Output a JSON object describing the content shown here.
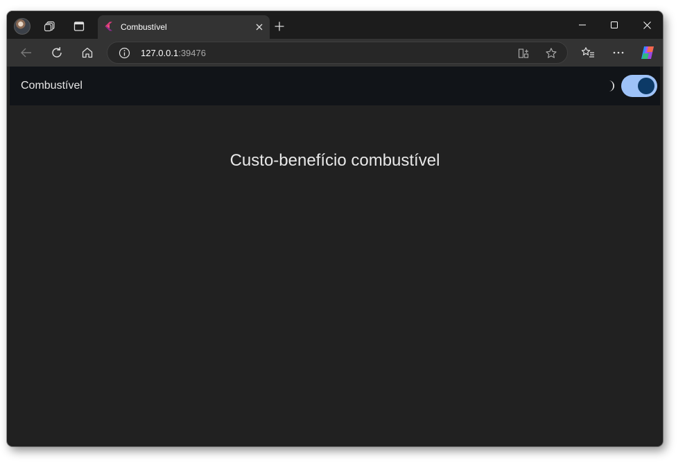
{
  "browser": {
    "tab": {
      "title": "Combustível",
      "favicon": "flutter-logo-icon"
    },
    "address": {
      "host": "127.0.0.1",
      "port": ":39476"
    },
    "colors": {
      "frame": "#1c1c1c",
      "toolbar": "#333333",
      "tab_active": "#333333"
    }
  },
  "app": {
    "appbar_title": "Combustível",
    "theme_icon": "moon-icon",
    "dark_mode_enabled": true,
    "heading": "Custo-benefício combustível",
    "colors": {
      "appbar": "#111418",
      "background": "#212121",
      "switch_track": "#9ec2f7",
      "switch_thumb": "#0c3a67"
    }
  }
}
